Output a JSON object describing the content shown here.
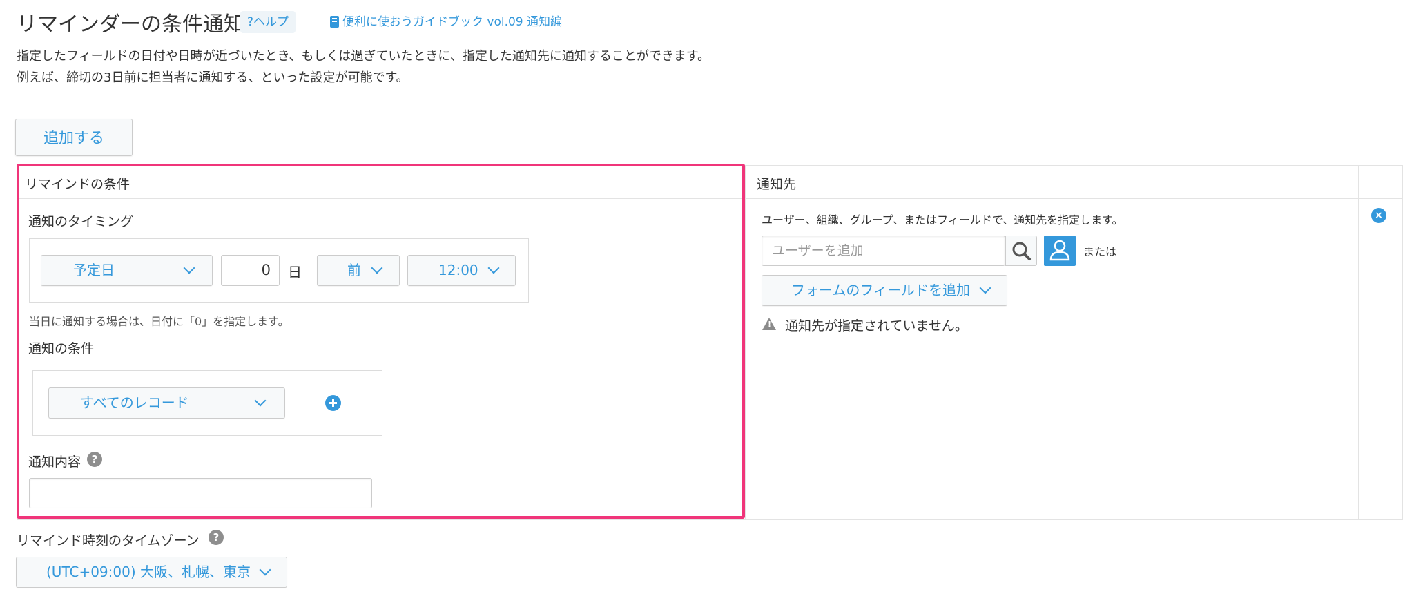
{
  "header": {
    "title": "リマインダーの条件通知",
    "help_label": "?ヘルプ",
    "guide_label": "便利に使おうガイドブック vol.09 通知編"
  },
  "description": {
    "line1": "指定したフィールドの日付や日時が近づいたとき、もしくは過ぎていたときに、指定した通知先に通知することができます。",
    "line2": "例えば、締切の3日前に担当者に通知する、といった設定が可能です。"
  },
  "add_button_label": "追加する",
  "table": {
    "col_condition": "リマインドの条件",
    "col_recipient": "通知先"
  },
  "timing": {
    "label": "通知のタイミング",
    "field_select": "予定日",
    "days_value": "0",
    "days_unit": "日",
    "direction_select": "前",
    "time_select": "12:00",
    "hint": "当日に通知する場合は、日付に「0」を指定します。"
  },
  "condition": {
    "label": "通知の条件",
    "record_select": "すべてのレコード"
  },
  "content": {
    "label": "通知内容",
    "value": ""
  },
  "recipients": {
    "description": "ユーザー、組織、グループ、またはフィールドで、通知先を指定します。",
    "user_placeholder": "ユーザーを追加",
    "or_label": "または",
    "field_button": "フォームのフィールドを追加",
    "warning": "通知先が指定されていません。"
  },
  "timezone": {
    "label": "リマインド時刻のタイムゾーン",
    "select": "(UTC+09:00) 大阪、札幌、東京"
  },
  "colors": {
    "accent": "#3498db",
    "highlight": "#f0357a"
  }
}
